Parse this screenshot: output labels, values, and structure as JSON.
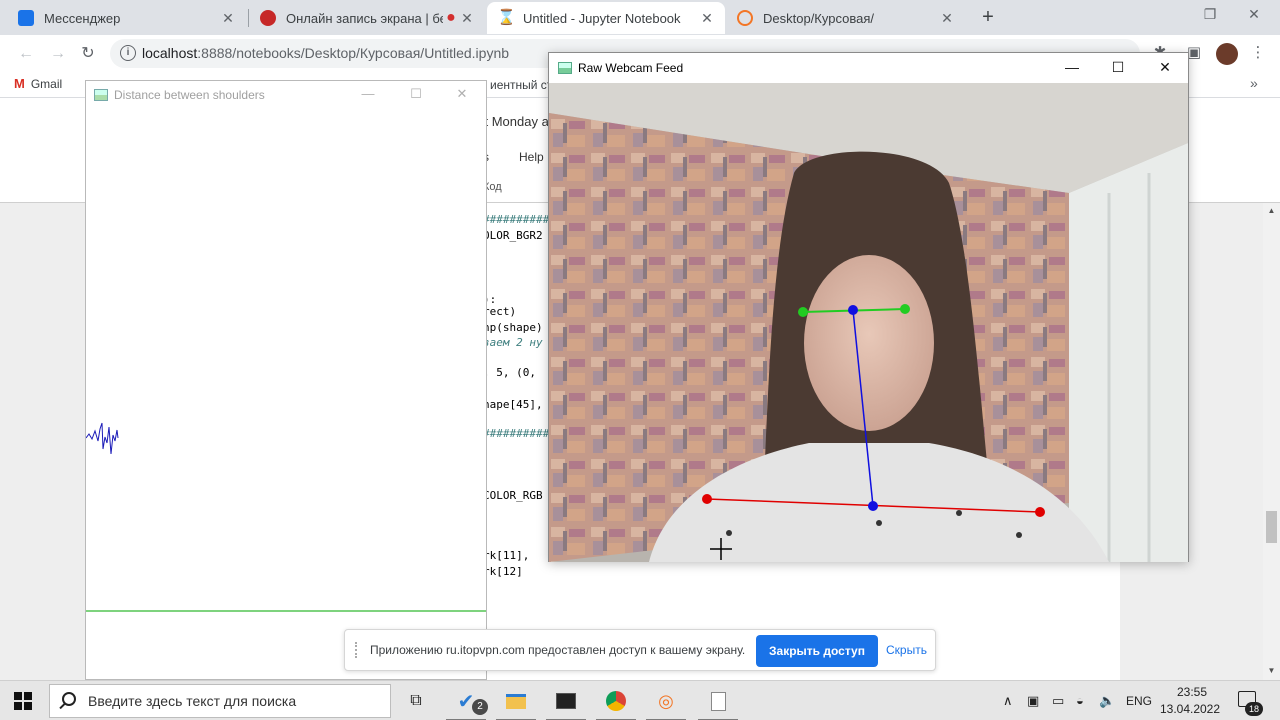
{
  "browser": {
    "tabs": [
      {
        "title": "Мессенджер",
        "color": "#1a73e8"
      },
      {
        "title": "Онлайн запись экрана | бе",
        "color": "#c62828"
      },
      {
        "title": "Untitled - Jupyter Notebook",
        "color": "#f37626"
      },
      {
        "title": "Desktop/Курсовая/",
        "color": "#f37626"
      }
    ],
    "new_tab_label": "+",
    "url_host": "localhost",
    "url_rest": ":8888/notebooks/Desktop/Курсовая/Untitled.ipynb",
    "bookmark_gmail": "Gmail",
    "bookmark_partial": "иентный ст"
  },
  "jupyter": {
    "last_save": "st Monday a",
    "menus": "s",
    "help": "Help",
    "cell_type": "Код",
    "code_lines": [
      {
        "text": "##########",
        "kind": "hash"
      },
      {
        "text": "OLOR_BGR2",
        "kind": "plain"
      },
      {
        "text": "):",
        "kind": "plain"
      },
      {
        "text": "rect)",
        "kind": "plain"
      },
      {
        "text": "np(shape)",
        "kind": "plain"
      },
      {
        "text": "ваем 2 ну",
        "kind": "cm"
      },
      {
        "text": ", 5, (0,",
        "kind": "plain"
      },
      {
        "text": "hape[45],",
        "kind": "plain"
      },
      {
        "text": "##########",
        "kind": "hash"
      },
      {
        "text": "COLOR_RGB",
        "kind": "plain"
      },
      {
        "text": "rk[11],",
        "kind": "plain"
      },
      {
        "text": "rk[12]",
        "kind": "plain"
      }
    ]
  },
  "distance_window": {
    "title": "Distance between shoulders",
    "signal_color": "#1a1ab8",
    "baseline_color": "#7ed37e"
  },
  "webcam_window": {
    "title": "Raw Webcam Feed",
    "eye_line_color": "#22cc22",
    "center_line_color": "#1010e0",
    "shoulder_line_color": "#e00000"
  },
  "share_bar": {
    "message": "Приложению ru.itopvpn.com предоставлен доступ к вашему экрану.",
    "stop_label": "Закрыть доступ",
    "hide_label": "Скрыть"
  },
  "taskbar": {
    "search_placeholder": "Введите здесь текст для поиска",
    "badge_count": "2",
    "language": "ENG",
    "time": "23:55",
    "date": "13.04.2022",
    "notification_count": "18"
  }
}
